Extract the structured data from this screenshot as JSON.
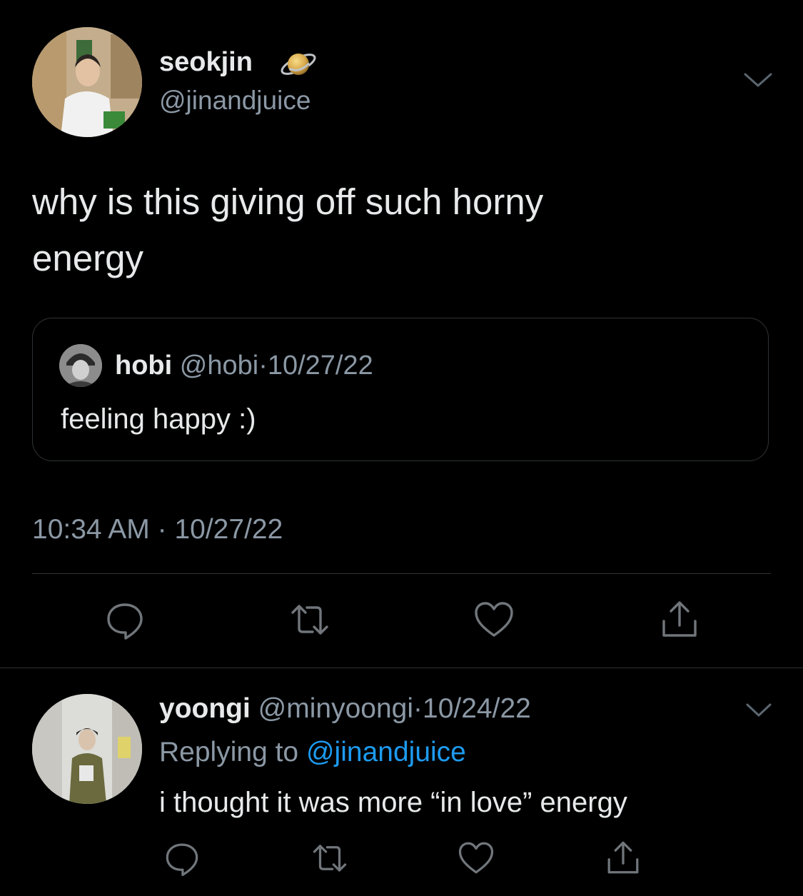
{
  "colors": {
    "background": "#000000",
    "primary_text": "#e7e9ea",
    "secondary_text": "#8b98a5",
    "link": "#1d9bf0",
    "divider": "#2f3336"
  },
  "main_tweet": {
    "author": {
      "display_name": "seokjin",
      "badge_icon": "planet-emoji",
      "handle": "@jinandjuice"
    },
    "text": "why is this giving off such horny\nenergy",
    "quoted_tweet": {
      "name": "hobi",
      "handle": "@hobi",
      "separator": "·",
      "date": "10/27/22",
      "text": "feeling happy :)"
    },
    "timestamp": {
      "time": "10:34 AM",
      "separator": "·",
      "date": "10/27/22"
    },
    "actions": [
      "reply-icon",
      "retweet-icon",
      "like-icon",
      "share-icon"
    ]
  },
  "reply_tweet": {
    "author": {
      "display_name": "yoongi",
      "handle": "@minyoongi",
      "separator": "·",
      "date": "10/24/22"
    },
    "replying_to_label": "Replying to",
    "replying_to_handle": "@jinandjuice",
    "text": "i thought it was more “in love” energy",
    "actions": [
      "reply-icon",
      "retweet-icon",
      "like-icon",
      "share-icon"
    ]
  }
}
